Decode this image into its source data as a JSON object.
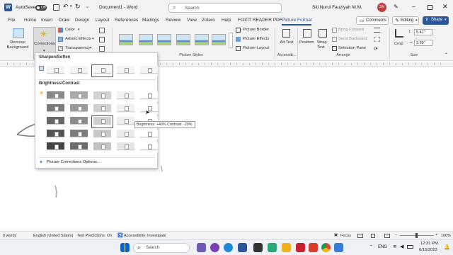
{
  "titlebar": {
    "autosave_label": "AutoSave",
    "autosave_state": "Off",
    "doc_title": "Document1 - Word",
    "search_placeholder": "Search",
    "user_name": "Siti Nurul Fauziyah M.M.",
    "user_initials": "SN"
  },
  "tabs": [
    "File",
    "Home",
    "Insert",
    "Draw",
    "Design",
    "Layout",
    "References",
    "Mailings",
    "Review",
    "View",
    "Zotero",
    "Help",
    "FOXIT READER PDF",
    "Picture Format"
  ],
  "active_tab": "Picture Format",
  "ribbon_right": {
    "comments": "Comments",
    "editing": "Editing",
    "share": "Share"
  },
  "ribbon": {
    "remove_background": "Remove Background",
    "corrections": "Corrections",
    "color": "Color",
    "artistic_effects": "Artistic Effects",
    "transparency": "Transparency",
    "picture_styles_label": "Picture Styles",
    "picture_border": "Picture Border",
    "picture_effects": "Picture Effects",
    "picture_layout": "Picture Layout",
    "alt_text": "Alt Text",
    "accessibility_label": "Accessib...",
    "position": "Position",
    "wrap_text": "Wrap Text",
    "bring_forward": "Bring Forward",
    "send_backward": "Send Backward",
    "selection_pane": "Selection Pane",
    "arrange_label": "Arrange",
    "crop": "Crop",
    "height_value": "5.41\"",
    "width_value": "3.69\"",
    "size_label": "Size"
  },
  "gallery": {
    "sharpen_heading": "Sharpen/Soften",
    "brightness_heading": "Brightness/Contrast",
    "options_link": "Picture Corrections Options...",
    "tooltip": "Brightness: +40% Contrast: -20%"
  },
  "statusbar": {
    "words": "0 words",
    "language": "English (United States)",
    "text_predictions": "Text Predictions: On",
    "accessibility": "Accessibility: Investigate",
    "focus": "Focus",
    "zoom": "100%"
  },
  "taskbar": {
    "search_placeholder": "Search",
    "language": "ENG",
    "time": "12:31 PM",
    "date": "6/16/2023"
  }
}
